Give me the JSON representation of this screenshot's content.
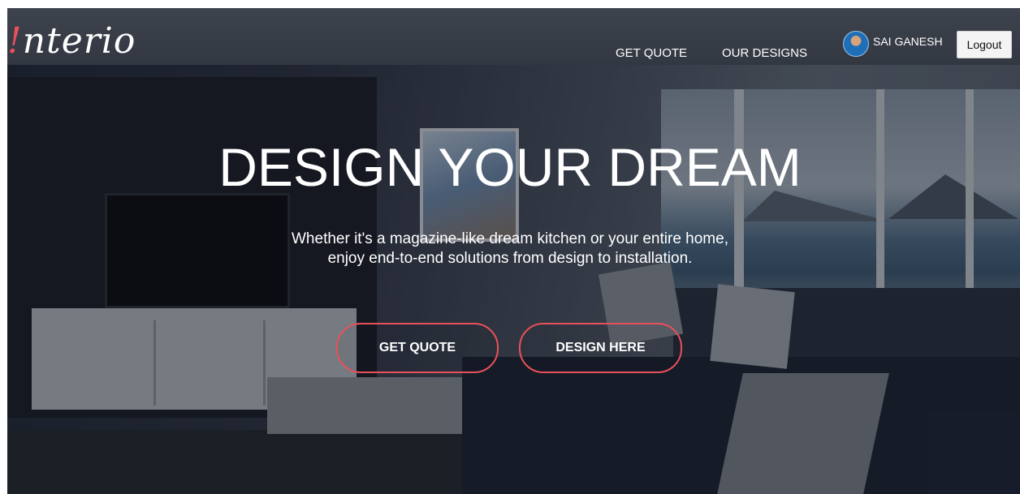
{
  "header": {
    "logo_mark": "!",
    "logo_text": "nterio",
    "nav": {
      "get_quote": "GET QUOTE",
      "our_designs": "OUR DESIGNS"
    },
    "user": {
      "name": "SAI GANESH",
      "avatar_icon": "user-avatar-icon"
    },
    "logout_label": "Logout"
  },
  "hero": {
    "headline": "DESIGN YOUR DREAM",
    "subtext": "Whether it's a magazine-like dream kitchen or your entire home, enjoy end-to-end solutions from design to installation.",
    "buttons": {
      "get_quote": "GET QUOTE",
      "design_here": "DESIGN HERE"
    }
  },
  "colors": {
    "accent": "#e8505b",
    "text": "#ffffff",
    "logout_bg": "#f4f4f4"
  }
}
